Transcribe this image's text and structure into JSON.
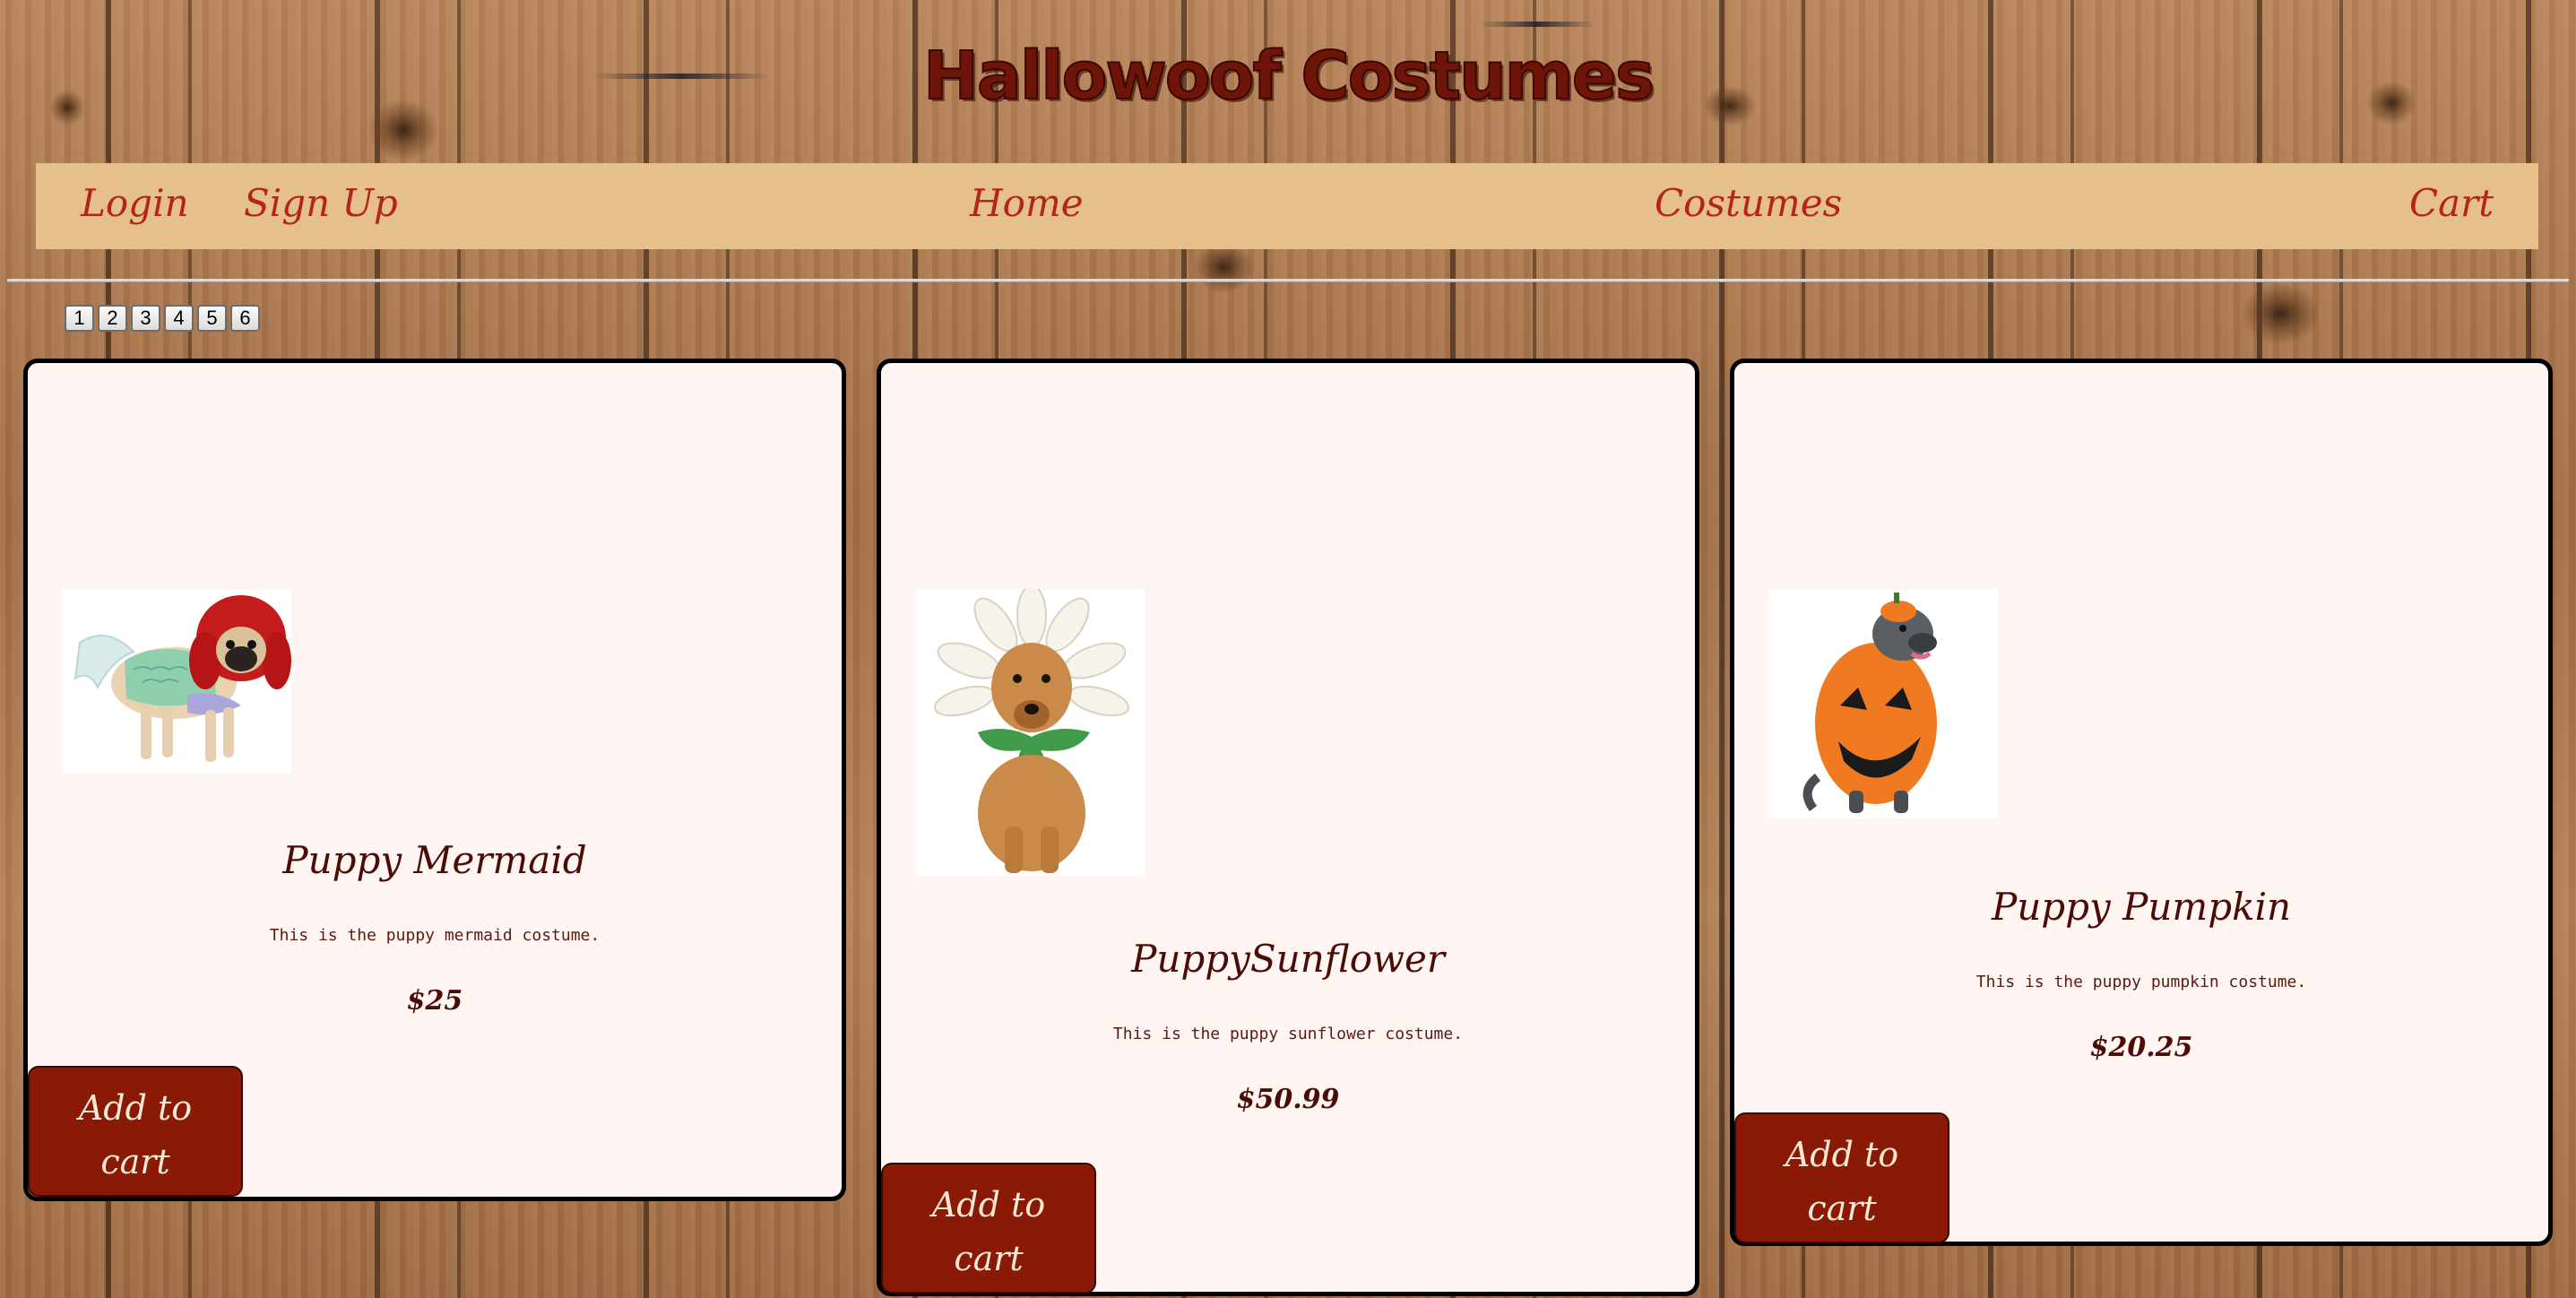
{
  "site": {
    "title": "Hallowoof Costumes"
  },
  "nav": {
    "login": "Login",
    "signup": "Sign Up",
    "home": "Home",
    "costumes": "Costumes",
    "cart": "Cart"
  },
  "pagination": [
    "1",
    "2",
    "3",
    "4",
    "5",
    "6"
  ],
  "products": [
    {
      "name": "Puppy Mermaid",
      "description": "This is the puppy mermaid costume.",
      "price": "$25",
      "button_label": "Add to cart"
    },
    {
      "name": "PuppySunflower",
      "description": "This is the puppy sunflower costume.",
      "price": "$50.99",
      "button_label": "Add to cart"
    },
    {
      "name": "Puppy Pumpkin",
      "description": "This is the puppy pumpkin costume.",
      "price": "$20.25",
      "button_label": "Add to cart"
    }
  ],
  "colors": {
    "title": "#6e1408",
    "nav_bg": "#e6c08a",
    "nav_link": "#b3241a",
    "card_bg": "#fff5f3",
    "button_bg": "#8a1a06",
    "button_text": "#f6ead6"
  }
}
